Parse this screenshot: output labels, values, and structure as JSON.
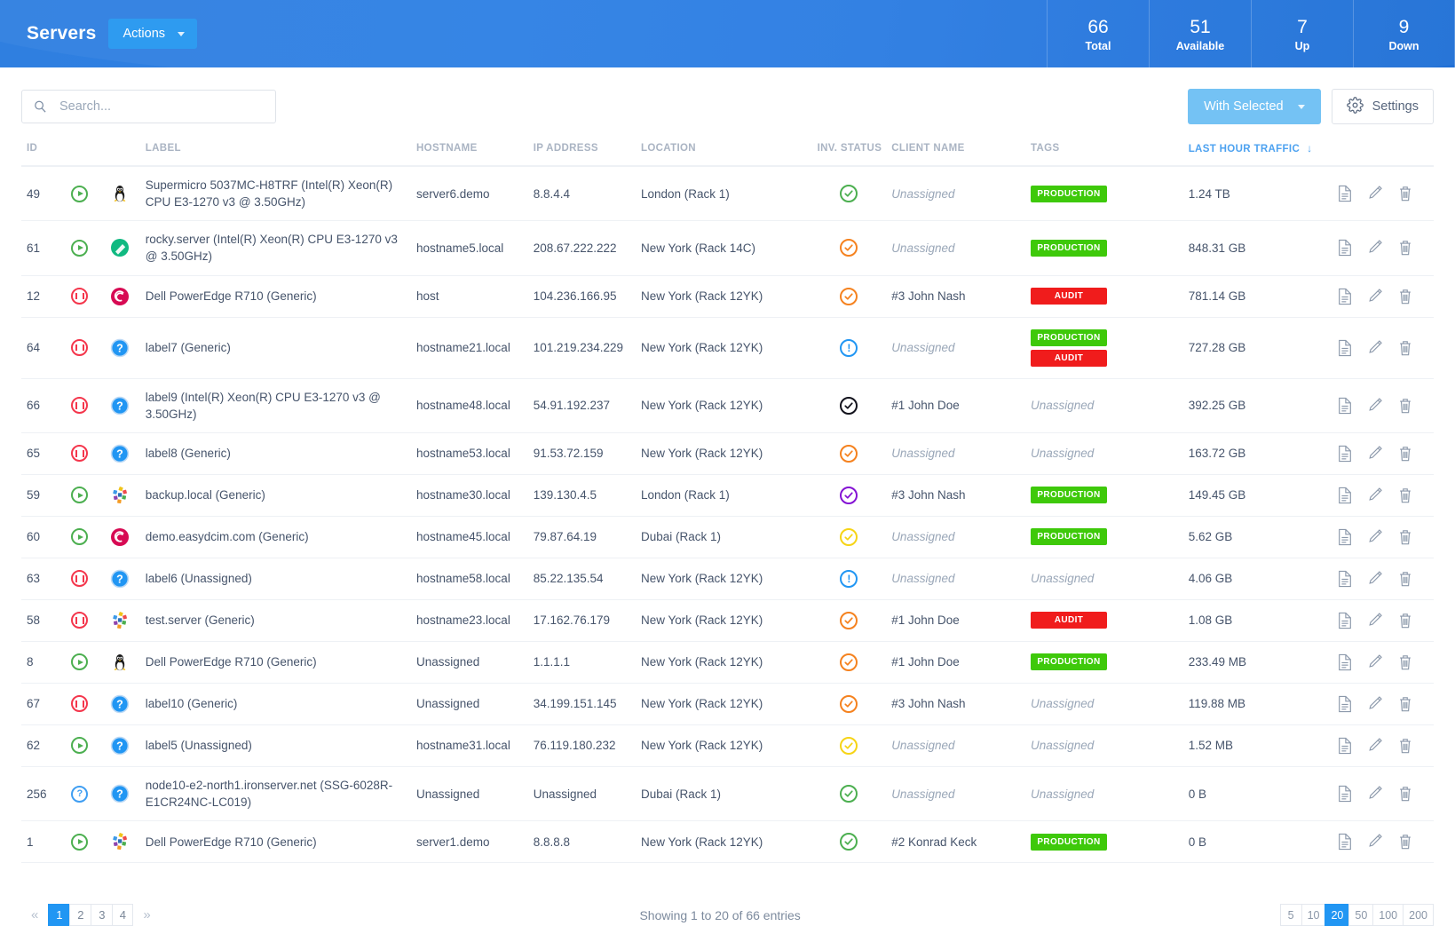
{
  "header": {
    "title": "Servers",
    "actions_label": "Actions",
    "stats": [
      {
        "value": "66",
        "label": "Total"
      },
      {
        "value": "51",
        "label": "Available"
      },
      {
        "value": "7",
        "label": "Up"
      },
      {
        "value": "9",
        "label": "Down"
      }
    ]
  },
  "toolbar": {
    "search_placeholder": "Search...",
    "search_value": "",
    "with_selected_label": "With Selected",
    "settings_label": "Settings"
  },
  "table": {
    "columns": [
      {
        "key": "id",
        "label": "ID"
      },
      {
        "key": "state",
        "label": ""
      },
      {
        "key": "os",
        "label": ""
      },
      {
        "key": "label",
        "label": "LABEL"
      },
      {
        "key": "hostname",
        "label": "HOSTNAME"
      },
      {
        "key": "ip",
        "label": "IP ADDRESS"
      },
      {
        "key": "location",
        "label": "LOCATION"
      },
      {
        "key": "inv",
        "label": "INV. STATUS"
      },
      {
        "key": "client",
        "label": "CLIENT NAME"
      },
      {
        "key": "tags",
        "label": "TAGS"
      },
      {
        "key": "traffic",
        "label": "LAST HOUR TRAFFIC",
        "sorted": true,
        "sort_dir": "↓"
      },
      {
        "key": "actions",
        "label": ""
      }
    ],
    "rows": [
      {
        "id": "49",
        "state": "play",
        "os": "tux",
        "label": "Supermicro 5037MC-H8TRF (Intel(R) Xeon(R) CPU E3-1270 v3 @ 3.50GHz)",
        "hostname": "server6.demo",
        "ip": "8.8.4.4",
        "location": "London (Rack 1)",
        "inv": "check",
        "inv_color": "#4caf50",
        "client": "Unassigned",
        "client_unassigned": true,
        "tags": [
          "PRODUCTION"
        ],
        "traffic": "1.24 TB"
      },
      {
        "id": "61",
        "state": "play",
        "os": "rocky",
        "label": "rocky.server (Intel(R) Xeon(R) CPU E3-1270 v3 @ 3.50GHz)",
        "hostname": "hostname5.local",
        "ip": "208.67.222.222",
        "location": "New York (Rack 14C)",
        "inv": "check",
        "inv_color": "#f5821f",
        "client": "Unassigned",
        "client_unassigned": true,
        "tags": [
          "PRODUCTION"
        ],
        "traffic": "848.31 GB"
      },
      {
        "id": "12",
        "state": "pause",
        "os": "debian",
        "label": "Dell PowerEdge R710 (Generic)",
        "hostname": "host",
        "ip": "104.236.166.95",
        "location": "New York (Rack 12YK)",
        "inv": "check",
        "inv_color": "#f5821f",
        "client": "#3 John Nash",
        "client_unassigned": false,
        "tags": [
          "AUDIT"
        ],
        "traffic": "781.14 GB"
      },
      {
        "id": "64",
        "state": "pause",
        "os": "unknown",
        "label": "label7 (Generic)",
        "hostname": "hostname21.local",
        "ip": "101.219.234.229",
        "location": "New York (Rack 12YK)",
        "inv": "exclaim",
        "inv_color": "#2196f3",
        "client": "Unassigned",
        "client_unassigned": true,
        "tags": [
          "PRODUCTION",
          "AUDIT"
        ],
        "traffic": "727.28 GB"
      },
      {
        "id": "66",
        "state": "pause",
        "os": "unknown",
        "label": "label9 (Intel(R) Xeon(R) CPU E3-1270 v3 @ 3.50GHz)",
        "hostname": "hostname48.local",
        "ip": "54.91.192.237",
        "location": "New York (Rack 12YK)",
        "inv": "check",
        "inv_color": "#12121c",
        "client": "#1 John Doe",
        "client_unassigned": false,
        "tags": [],
        "tags_unassigned": "Unassigned",
        "traffic": "392.25 GB"
      },
      {
        "id": "65",
        "state": "pause",
        "os": "unknown",
        "label": "label8 (Generic)",
        "hostname": "hostname53.local",
        "ip": "91.53.72.159",
        "location": "New York (Rack 12YK)",
        "inv": "check",
        "inv_color": "#f5821f",
        "client": "Unassigned",
        "client_unassigned": true,
        "tags": [],
        "tags_unassigned": "Unassigned",
        "traffic": "163.72 GB"
      },
      {
        "id": "59",
        "state": "play",
        "os": "fedora",
        "label": "backup.local (Generic)",
        "hostname": "hostname30.local",
        "ip": "139.130.4.5",
        "location": "London (Rack 1)",
        "inv": "check",
        "inv_color": "#8412d4",
        "client": "#3 John Nash",
        "client_unassigned": false,
        "tags": [
          "PRODUCTION"
        ],
        "traffic": "149.45 GB"
      },
      {
        "id": "60",
        "state": "play",
        "os": "debian",
        "label": "demo.easydcim.com (Generic)",
        "hostname": "hostname45.local",
        "ip": "79.87.64.19",
        "location": "Dubai (Rack 1)",
        "inv": "check",
        "inv_color": "#f6d416",
        "client": "Unassigned",
        "client_unassigned": true,
        "tags": [
          "PRODUCTION"
        ],
        "traffic": "5.62 GB"
      },
      {
        "id": "63",
        "state": "pause",
        "os": "unknown",
        "label": "label6 (Unassigned)",
        "hostname": "hostname58.local",
        "ip": "85.22.135.54",
        "location": "New York (Rack 12YK)",
        "inv": "exclaim",
        "inv_color": "#2196f3",
        "client": "Unassigned",
        "client_unassigned": true,
        "tags": [],
        "tags_unassigned": "Unassigned",
        "traffic": "4.06 GB"
      },
      {
        "id": "58",
        "state": "pause",
        "os": "fedora",
        "label": "test.server (Generic)",
        "hostname": "hostname23.local",
        "ip": "17.162.76.179",
        "location": "New York (Rack 12YK)",
        "inv": "check",
        "inv_color": "#f5821f",
        "client": "#1 John Doe",
        "client_unassigned": false,
        "tags": [
          "AUDIT"
        ],
        "traffic": "1.08 GB"
      },
      {
        "id": "8",
        "state": "play",
        "os": "tux",
        "label": "Dell PowerEdge R710 (Generic)",
        "hostname": "Unassigned",
        "ip": "1.1.1.1",
        "location": "New York (Rack 12YK)",
        "inv": "check",
        "inv_color": "#f5821f",
        "client": "#1 John Doe",
        "client_unassigned": false,
        "tags": [
          "PRODUCTION"
        ],
        "traffic": "233.49 MB"
      },
      {
        "id": "67",
        "state": "pause",
        "os": "unknown",
        "label": "label10 (Generic)",
        "hostname": "Unassigned",
        "ip": "34.199.151.145",
        "location": "New York (Rack 12YK)",
        "inv": "check",
        "inv_color": "#f5821f",
        "client": "#3 John Nash",
        "client_unassigned": false,
        "tags": [],
        "tags_unassigned": "Unassigned",
        "traffic": "119.88 MB"
      },
      {
        "id": "62",
        "state": "play",
        "os": "unknown",
        "label": "label5 (Unassigned)",
        "hostname": "hostname31.local",
        "ip": "76.119.180.232",
        "location": "New York (Rack 12YK)",
        "inv": "check",
        "inv_color": "#f6d416",
        "client": "Unassigned",
        "client_unassigned": true,
        "tags": [],
        "tags_unassigned": "Unassigned",
        "traffic": "1.52 MB"
      },
      {
        "id": "256",
        "state": "unknown",
        "os": "unknown",
        "label": "node10-e2-north1.ironserver.net (SSG-6028R-E1CR24NC-LC019)",
        "hostname": "Unassigned",
        "ip": "Unassigned",
        "location": "Dubai (Rack 1)",
        "inv": "check",
        "inv_color": "#4caf50",
        "client": "Unassigned",
        "client_unassigned": true,
        "tags": [],
        "tags_unassigned": "Unassigned",
        "traffic": "0 B"
      },
      {
        "id": "1",
        "state": "play",
        "os": "fedora",
        "label": "Dell PowerEdge R710 (Generic)",
        "hostname": "server1.demo",
        "ip": "8.8.8.8",
        "location": "New York (Rack 12YK)",
        "inv": "check",
        "inv_color": "#4caf50",
        "client": "#2 Konrad Keck",
        "client_unassigned": false,
        "tags": [
          "PRODUCTION"
        ],
        "traffic": "0 B"
      }
    ],
    "row_actions": [
      "document-icon",
      "pencil-icon",
      "trash-icon"
    ]
  },
  "footer": {
    "prev_label": "«",
    "next_label": "»",
    "pages": [
      "1",
      "2",
      "3",
      "4"
    ],
    "active_page": "1",
    "showing_text": "Showing 1 to 20 of 66 entries",
    "page_sizes": [
      "5",
      "10",
      "20",
      "50",
      "100",
      "200"
    ],
    "active_page_size": "20"
  },
  "colors": {
    "brand_blue": "#2d80e4",
    "accent_blue": "#2196f3",
    "tag_production": "#3ec90a",
    "tag_audit": "#f01c1c",
    "state_up": "#4caf50",
    "state_down": "#f4364c"
  }
}
